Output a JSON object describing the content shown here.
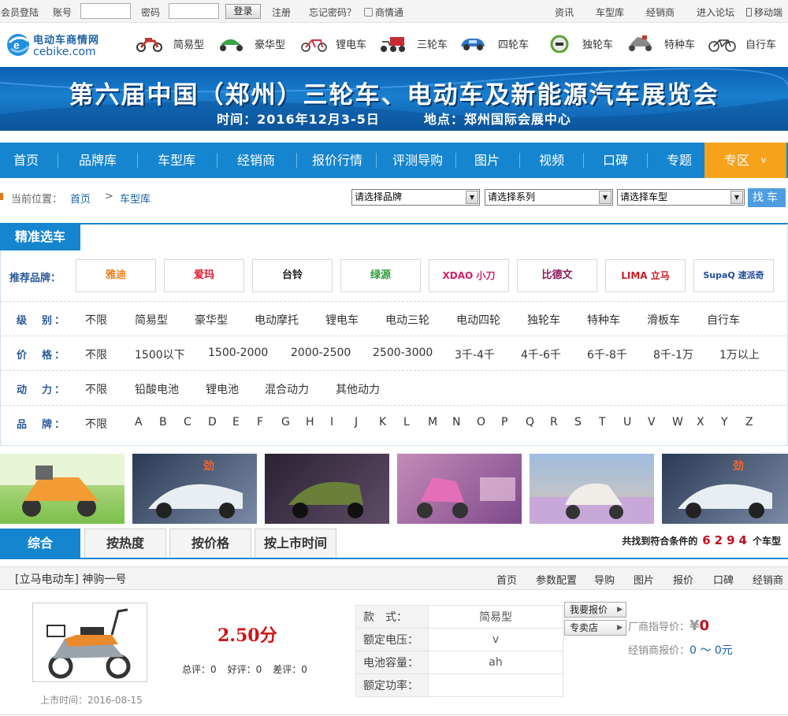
{
  "topbar": {
    "member_login": "会员登陆",
    "account_label": "账号",
    "account_value": "",
    "password_label": "密码",
    "password_value": "",
    "login_button": "登录",
    "register": "注册",
    "forgot": "忘记密码？",
    "business": "商情通",
    "right_links": [
      "资讯",
      "车型库",
      "经销商",
      "进入论坛",
      "移动端"
    ]
  },
  "logo": {
    "title": "电动车商情网",
    "url": "cebike.com"
  },
  "categories": [
    "简易型",
    "豪华型",
    "锂电车",
    "三轮车",
    "四轮车",
    "独轮车",
    "特种车",
    "自行车"
  ],
  "banner": {
    "title": "第六届中国（郑州）三轮车、电动车及新能源汽车展览会",
    "time": "时间：2016年12月3-5日",
    "place": "地点：郑州国际会展中心"
  },
  "nav": {
    "items": [
      "首页",
      "品牌库",
      "车型库",
      "经销商",
      "报价行情",
      "评测导购",
      "图片",
      "视频",
      "口碑",
      "专题"
    ],
    "zone": "专区"
  },
  "breadcrumb": {
    "label": "当前位置：",
    "home": "首页",
    "sep": ">",
    "current": "车型库"
  },
  "selects": {
    "brand": "请选择品牌",
    "series": "请选择系列",
    "model": "请选择车型"
  },
  "find_button": "找车",
  "panel": {
    "tab": "精准选车",
    "brand_label": "推荐品牌：",
    "brands": [
      {
        "name": "雅迪",
        "color": "#f07d1c"
      },
      {
        "name": "爱玛",
        "color": "#d8182d"
      },
      {
        "name": "台铃",
        "color": "#222222"
      },
      {
        "name": "绿源",
        "color": "#2f9b3a"
      },
      {
        "name": "XDAO 小刀",
        "color": "#d21f66"
      },
      {
        "name": "比德文",
        "color": "#8a1b5e"
      },
      {
        "name": "LIMA 立马",
        "color": "#c81f25"
      },
      {
        "name": "SupaQ 速派奇",
        "color": "#1e4fa0"
      }
    ],
    "rows": [
      {
        "label": "级　别：",
        "options": [
          "不限",
          "简易型",
          "豪华型",
          "电动摩托",
          "锂电车",
          "电动三轮",
          "电动四轮",
          "独轮车",
          "特种车",
          "滑板车",
          "自行车"
        ]
      },
      {
        "label": "价　格：",
        "options": [
          "不限",
          "1500以下",
          "1500-2000",
          "2000-2500",
          "2500-3000",
          "3千-4千",
          "4千-6千",
          "6千-8千",
          "8千-1万",
          "1万以上"
        ]
      },
      {
        "label": "动　力：",
        "options": [
          "不限",
          "铅酸电池",
          "锂电池",
          "混合动力",
          "其他动力"
        ]
      },
      {
        "label": "品　牌：",
        "options": [
          "不限",
          "A",
          "B",
          "C",
          "D",
          "E",
          "F",
          "G",
          "H",
          "I",
          "J",
          "K",
          "L",
          "M",
          "N",
          "O",
          "P",
          "Q",
          "R",
          "S",
          "T",
          "U",
          "V",
          "W",
          "X",
          "Y",
          "Z"
        ]
      }
    ]
  },
  "sort_tabs": [
    "综合",
    "按热度",
    "按价格",
    "按上市时间"
  ],
  "result": {
    "prefix": "共找到符合条件的",
    "count": "6294",
    "suffix": "个车型"
  },
  "listing": {
    "title": "[立马电动车] 神驹一号",
    "links": [
      "首页",
      "参数配置",
      "导购",
      "图片",
      "报价",
      "口碑",
      "经销商"
    ],
    "score": "2.50分",
    "total": "总评：0",
    "good": "好评：0",
    "bad": "差评：0",
    "launch": "上市时间：2016-08-15",
    "specs": [
      {
        "k": "款　式：",
        "v": "简易型"
      },
      {
        "k": "额定电压：",
        "v": "v"
      },
      {
        "k": "电池容量：",
        "v": "ah"
      },
      {
        "k": "额定功率：",
        "v": ""
      }
    ],
    "quote_button": "我要报价",
    "store_button": "专卖店",
    "guide_label": "厂商指导价：",
    "guide_yen": "¥",
    "guide_price": "0",
    "dealer_label": "经销商报价：",
    "dealer_price": "0 ～ 0元"
  }
}
